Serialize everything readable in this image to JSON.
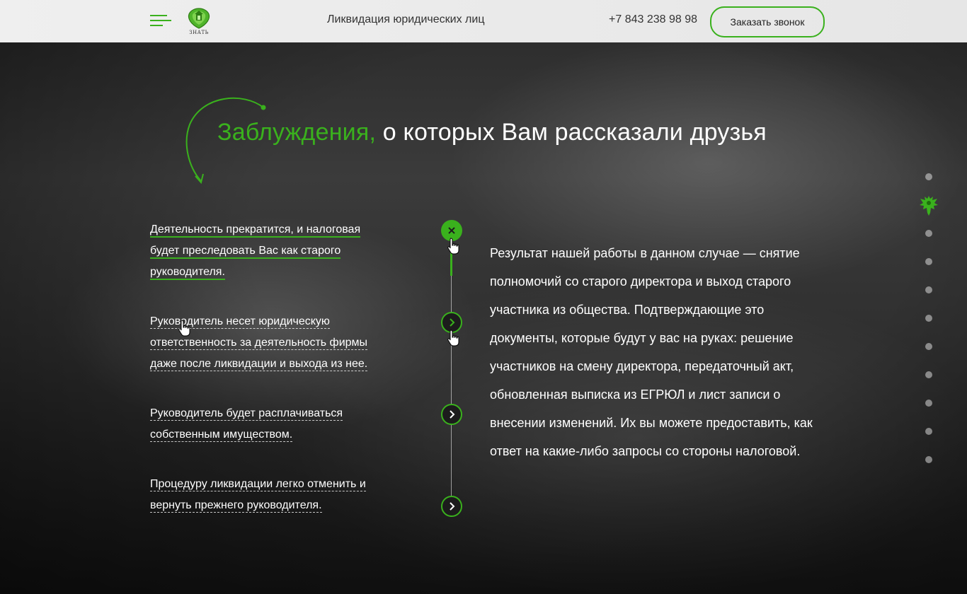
{
  "header": {
    "title": "Ликвидация юридических лиц",
    "phone": "+7 843 238 98 98",
    "callback_button": "Заказать звонок",
    "logo_text": "ЗНАТЬ"
  },
  "section": {
    "heading_accent": "Заблуждения,",
    "heading_rest": " о которых Вам рассказали друзья"
  },
  "myths": [
    {
      "text": "Деятельность прекратится, и налоговая будет преследовать Вас как старого руководителя."
    },
    {
      "text": "Руководитель несет юридическую ответственность за деятельность фирмы даже после ликвидации и выхода из нее."
    },
    {
      "text": "Руководитель будет расплачиваться собственным имуществом."
    },
    {
      "text": "Процедуру ликвидации легко отменить и вернуть прежнего руководителя."
    }
  ],
  "answer": {
    "text": "Результат нашей работы в данном случае — снятие полномочий со старого директора и выход старого участника из общества. Подтверждающие это документы, которые будут у вас на руках: решение участников на смену директора, передаточный акт, обновленная выписка из ЕГРЮЛ и лист записи о внесении изменений. Их вы можете предоставить, как ответ на какие-либо запросы со стороны налоговой."
  },
  "timeline": {
    "active_index": 0,
    "active_icon": "close-icon",
    "inactive_icon": "chevron-right-icon"
  },
  "pager": {
    "total": 11,
    "active_index": 1,
    "active_icon": "eagle-emblem-icon"
  },
  "colors": {
    "accent": "#3ab11d",
    "header_bg": "#ececec",
    "text_dark": "#333333",
    "text_light": "#ffffff"
  }
}
